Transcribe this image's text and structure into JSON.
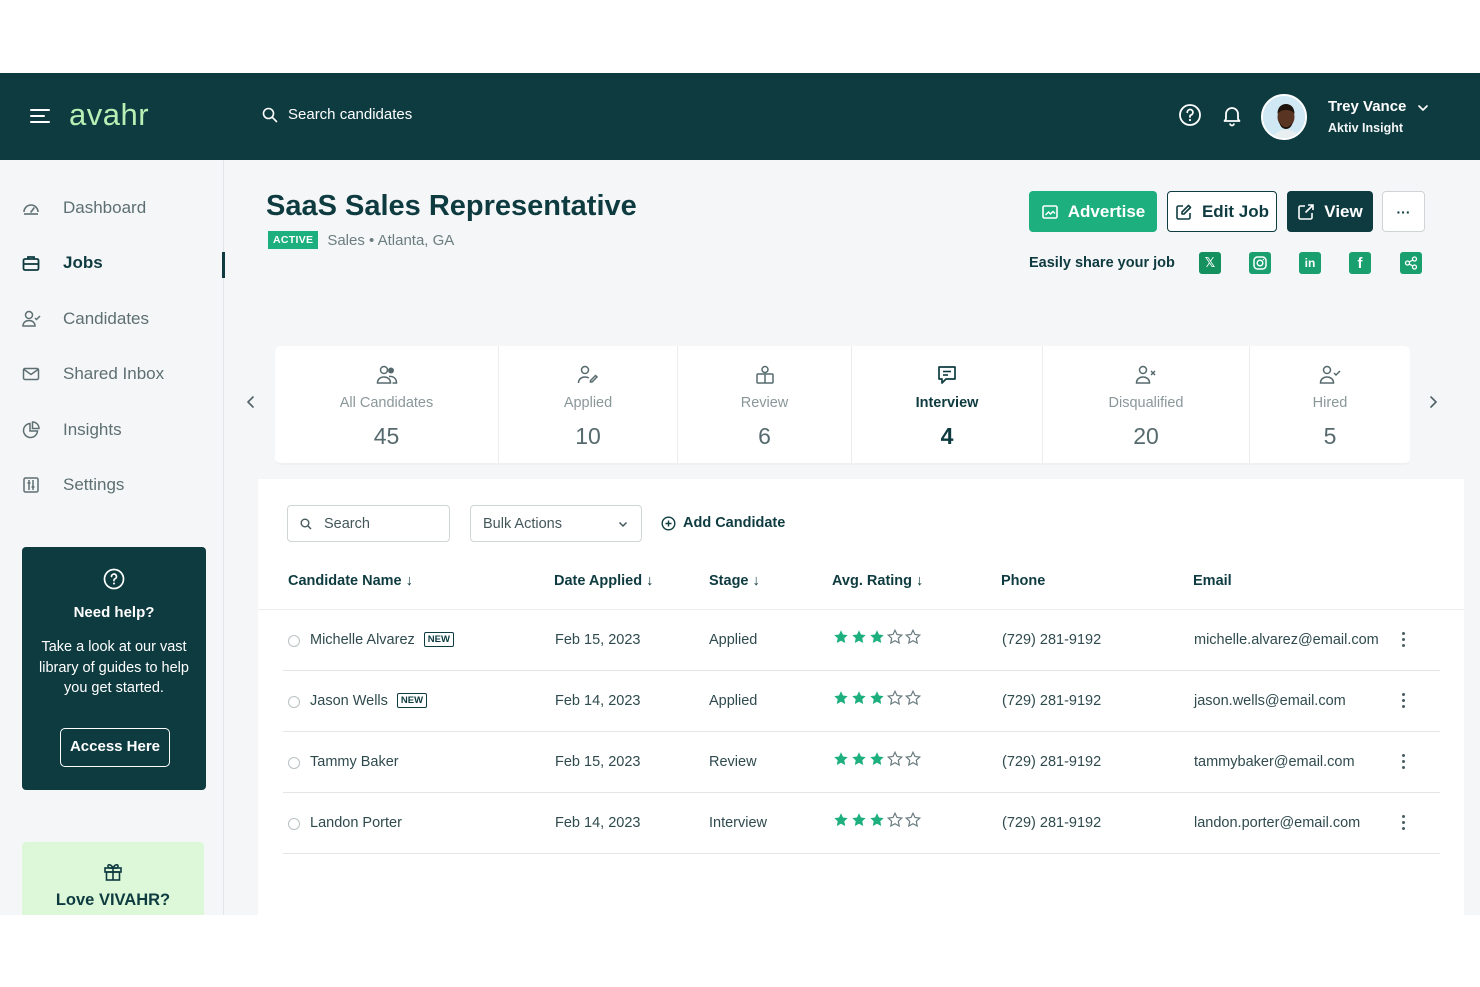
{
  "topbar": {
    "logo": "avahr",
    "search_placeholder": "Search candidates",
    "user_name": "Trey Vance",
    "user_company": "Aktiv Insight"
  },
  "sidebar": {
    "items": [
      {
        "label": "Dashboard",
        "icon": "dashboard-icon"
      },
      {
        "label": "Jobs",
        "icon": "briefcase-icon",
        "active": true
      },
      {
        "label": "Candidates",
        "icon": "user-check-icon"
      },
      {
        "label": "Shared Inbox",
        "icon": "mail-icon"
      },
      {
        "label": "Insights",
        "icon": "pie-chart-icon"
      },
      {
        "label": "Settings",
        "icon": "sliders-icon"
      }
    ],
    "help": {
      "title": "Need help?",
      "text": "Take a look at our vast library of guides to help you get started.",
      "button": "Access Here"
    },
    "love": {
      "title": "Love VIVAHR?"
    }
  },
  "job": {
    "title": "SaaS Sales Representative",
    "status": "ACTIVE",
    "meta": "Sales • Atlanta, GA",
    "buttons": {
      "advertise": "Advertise",
      "edit": "Edit Job",
      "view": "View",
      "more": "···"
    },
    "share_label": "Easily share your job"
  },
  "stages": [
    {
      "label": "All Candidates",
      "count": "45",
      "icon": "users-icon"
    },
    {
      "label": "Applied",
      "count": "10",
      "icon": "user-edit-icon"
    },
    {
      "label": "Review",
      "count": "6",
      "icon": "review-icon"
    },
    {
      "label": "Interview",
      "count": "4",
      "icon": "chat-icon",
      "selected": true
    },
    {
      "label": "Disqualified",
      "count": "20",
      "icon": "user-x-icon"
    },
    {
      "label": "Hired",
      "count": "5",
      "icon": "user-check-icon"
    }
  ],
  "table": {
    "search_placeholder": "Search",
    "bulk_actions": "Bulk Actions",
    "add_candidate": "Add Candidate",
    "columns": [
      "Candidate Name ↓",
      "Date Applied ↓",
      "Stage ↓",
      "Avg. Rating ↓",
      "Phone",
      "Email"
    ],
    "new_label": "NEW",
    "rows": [
      {
        "name": "Michelle Alvarez",
        "is_new": true,
        "date": "Feb 15, 2023",
        "stage": "Applied",
        "rating": 3,
        "phone": "(729) 281-9192",
        "email": "michelle.alvarez@email.com"
      },
      {
        "name": "Jason Wells",
        "is_new": true,
        "date": "Feb 14, 2023",
        "stage": "Applied",
        "rating": 3,
        "phone": "(729) 281-9192",
        "email": "jason.wells@email.com"
      },
      {
        "name": "Tammy Baker",
        "is_new": false,
        "date": "Feb 15, 2023",
        "stage": "Review",
        "rating": 3,
        "phone": "(729) 281-9192",
        "email": "tammybaker@email.com"
      },
      {
        "name": "Landon Porter",
        "is_new": false,
        "date": "Feb 14, 2023",
        "stage": "Interview",
        "rating": 3,
        "phone": "(729) 281-9192",
        "email": "landon.porter@email.com"
      }
    ]
  },
  "colors": {
    "primary": "#0e3b40",
    "accent": "#1eaf7e",
    "logo": "#b7f0b5"
  }
}
